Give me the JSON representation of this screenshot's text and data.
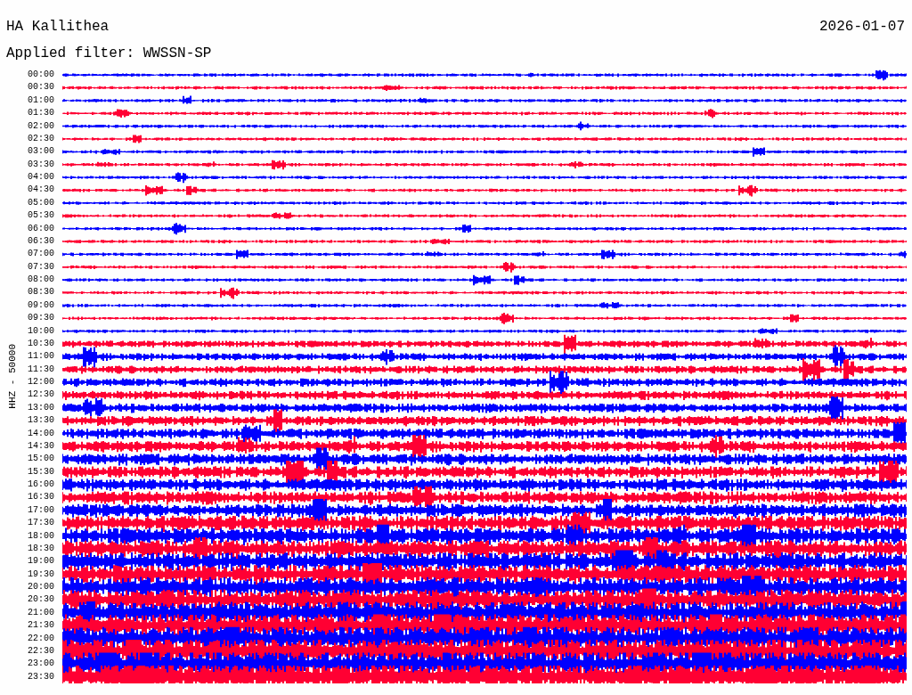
{
  "header": {
    "station": "HA Kallithea",
    "date": "2026-01-07",
    "filter": "Applied filter: WWSSN-SP"
  },
  "plot": {
    "axis_label": "HHZ - 50000",
    "rows": [
      {
        "time": "00:00",
        "color": "#0000ff"
      },
      {
        "time": "00:30",
        "color": "#ff0033"
      },
      {
        "time": "01:00",
        "color": "#0000ff"
      },
      {
        "time": "01:30",
        "color": "#ff0033"
      },
      {
        "time": "02:00",
        "color": "#0000ff"
      },
      {
        "time": "02:30",
        "color": "#ff0033"
      },
      {
        "time": "03:00",
        "color": "#0000ff"
      },
      {
        "time": "03:30",
        "color": "#ff0033"
      },
      {
        "time": "04:00",
        "color": "#0000ff"
      },
      {
        "time": "04:30",
        "color": "#ff0033"
      },
      {
        "time": "05:00",
        "color": "#0000ff"
      },
      {
        "time": "05:30",
        "color": "#ff0033"
      },
      {
        "time": "06:00",
        "color": "#0000ff"
      },
      {
        "time": "06:30",
        "color": "#ff0033"
      },
      {
        "time": "07:00",
        "color": "#0000ff"
      },
      {
        "time": "07:30",
        "color": "#ff0033"
      },
      {
        "time": "08:00",
        "color": "#0000ff"
      },
      {
        "time": "08:30",
        "color": "#ff0033"
      },
      {
        "time": "09:00",
        "color": "#0000ff"
      },
      {
        "time": "09:30",
        "color": "#ff0033"
      },
      {
        "time": "10:00",
        "color": "#0000ff"
      },
      {
        "time": "10:30",
        "color": "#ff0033"
      },
      {
        "time": "11:00",
        "color": "#0000ff"
      },
      {
        "time": "11:30",
        "color": "#ff0033"
      },
      {
        "time": "12:00",
        "color": "#0000ff"
      },
      {
        "time": "12:30",
        "color": "#ff0033"
      },
      {
        "time": "13:00",
        "color": "#0000ff"
      },
      {
        "time": "13:30",
        "color": "#ff0033"
      },
      {
        "time": "14:00",
        "color": "#0000ff"
      },
      {
        "time": "14:30",
        "color": "#ff0033"
      },
      {
        "time": "15:00",
        "color": "#0000ff"
      },
      {
        "time": "15:30",
        "color": "#ff0033"
      },
      {
        "time": "16:00",
        "color": "#0000ff"
      },
      {
        "time": "16:30",
        "color": "#ff0033"
      },
      {
        "time": "17:00",
        "color": "#0000ff"
      },
      {
        "time": "17:30",
        "color": "#ff0033"
      },
      {
        "time": "18:00",
        "color": "#0000ff"
      },
      {
        "time": "18:30",
        "color": "#ff0033"
      },
      {
        "time": "19:00",
        "color": "#0000ff"
      },
      {
        "time": "19:30",
        "color": "#ff0033"
      },
      {
        "time": "20:00",
        "color": "#0000ff"
      },
      {
        "time": "20:30",
        "color": "#ff0033"
      },
      {
        "time": "21:00",
        "color": "#0000ff"
      },
      {
        "time": "21:30",
        "color": "#ff0033"
      },
      {
        "time": "22:00",
        "color": "#0000ff"
      },
      {
        "time": "22:30",
        "color": "#ff0033"
      },
      {
        "time": "23:00",
        "color": "#0000ff"
      },
      {
        "time": "23:30",
        "color": "#ff0033"
      }
    ]
  }
}
